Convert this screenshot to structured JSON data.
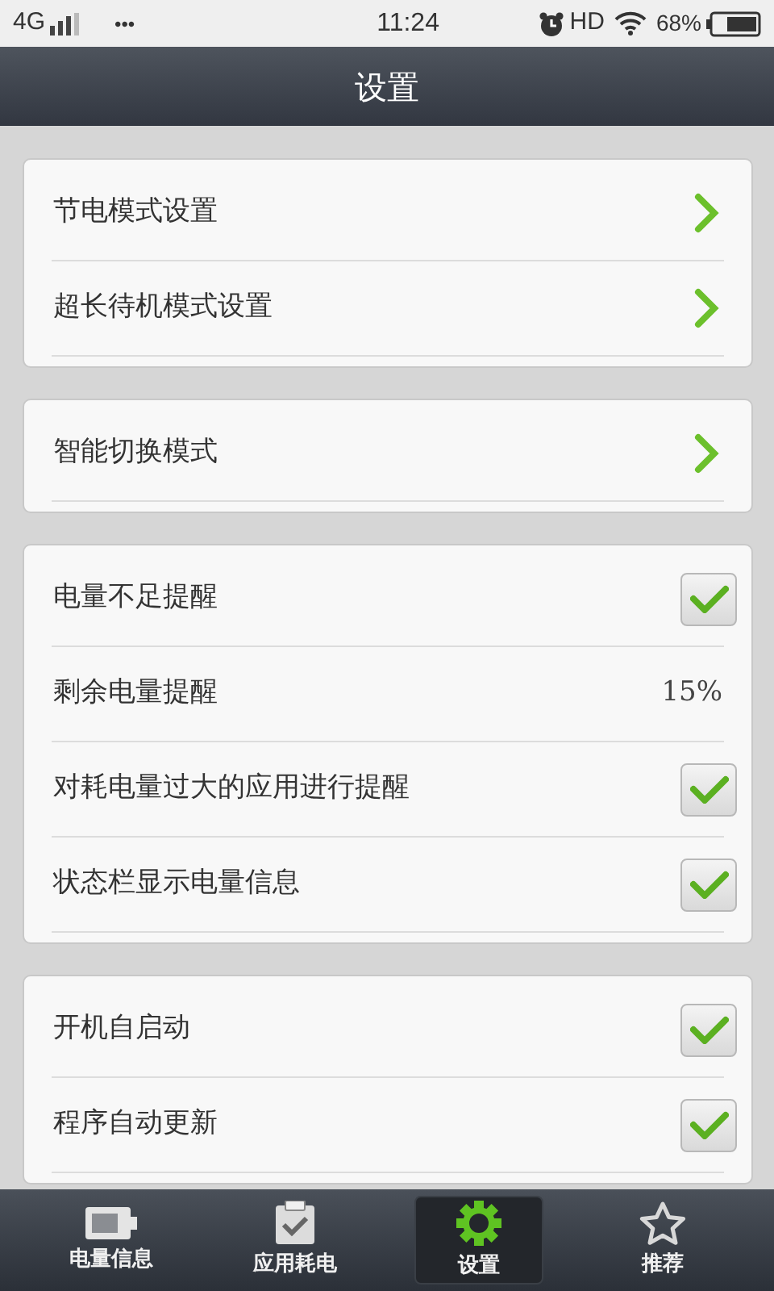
{
  "status_bar": {
    "network": "4G",
    "dots": "•••",
    "time": "11:24",
    "hd": "HD",
    "battery": "68%"
  },
  "title": "设置",
  "groups": [
    {
      "rows": [
        {
          "kind": "link",
          "label": "节电模式设置"
        },
        {
          "kind": "link",
          "label": "超长待机模式设置"
        }
      ]
    },
    {
      "rows": [
        {
          "kind": "link",
          "label": "智能切换模式"
        }
      ]
    },
    {
      "rows": [
        {
          "kind": "check",
          "label": "电量不足提醒",
          "checked": true
        },
        {
          "kind": "value",
          "label": "剩余电量提醒",
          "value": "15%"
        },
        {
          "kind": "check",
          "label": "对耗电量过大的应用进行提醒",
          "checked": true
        },
        {
          "kind": "check",
          "label": "状态栏显示电量信息",
          "checked": true
        }
      ]
    },
    {
      "rows": [
        {
          "kind": "check",
          "label": "开机自启动",
          "checked": true
        },
        {
          "kind": "check",
          "label": "程序自动更新",
          "checked": true
        }
      ]
    }
  ],
  "tabs": [
    {
      "label": "电量信息",
      "selected": false
    },
    {
      "label": "应用耗电",
      "selected": false
    },
    {
      "label": "设置",
      "selected": true
    },
    {
      "label": "推荐",
      "selected": false
    }
  ]
}
